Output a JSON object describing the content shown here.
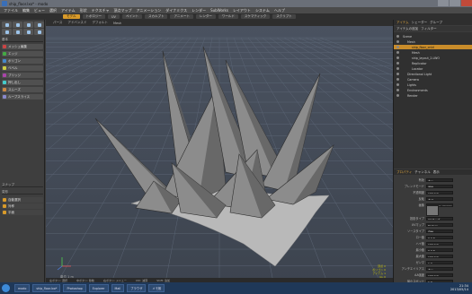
{
  "window": {
    "title": "ship_floor.lxo* - modo"
  },
  "menubar": [
    "ファイル",
    "編集",
    "ビュー",
    "選択",
    "アイテム",
    "形状",
    "テクスチャ",
    "頂点マップ",
    "アニメーション",
    "ダイナミクス",
    "レンダー",
    "SubWorks",
    "レイアウト",
    "システム",
    "ヘルプ"
  ],
  "layout_tabs": [
    {
      "label": "モデル",
      "active": true
    },
    {
      "label": "トポロジー",
      "active": false
    },
    {
      "label": "UV",
      "active": false
    },
    {
      "label": "ペイント",
      "active": false
    },
    {
      "label": "スカルプト",
      "active": false
    },
    {
      "label": "アニメート",
      "active": false
    },
    {
      "label": "レンダー",
      "active": false
    },
    {
      "label": "ワールド",
      "active": false
    },
    {
      "label": "スケマティック",
      "active": false
    },
    {
      "label": "スクリプト",
      "active": false
    }
  ],
  "left_panel": {
    "section1": "基本",
    "buttons": [
      "メッシュ編集",
      "エッジ",
      "ポリゴン",
      "ベベル",
      "ブリッジ",
      "押し出し",
      "スムーズ",
      "ループスライス"
    ],
    "section2": "スナップ",
    "section3": "変形",
    "checks": [
      "自動選択",
      "対称",
      "平面"
    ]
  },
  "viewport": {
    "header": [
      "パース",
      "アドバンスド",
      "デフォルト",
      "Mesh"
    ],
    "footer_left": "単位 1 m",
    "footer_right": [
      "頂点 0",
      "ポリゴン 0",
      "アイテム 1",
      "GL 0"
    ]
  },
  "right_panel": {
    "tabs": [
      {
        "label": "アイテム",
        "on": true
      },
      {
        "label": "シェーダー",
        "on": false
      },
      {
        "label": "グループ",
        "on": false
      }
    ],
    "subtabs": [
      {
        "label": "アイテムの追加",
        "on": false
      },
      {
        "label": "フィルター",
        "on": false
      }
    ],
    "tree": [
      {
        "label": "Scene",
        "indent": 0,
        "sel": false
      },
      {
        "label": "Mesh",
        "indent": 1,
        "sel": false
      },
      {
        "label": "ship_floor_cntrl",
        "indent": 2,
        "sel": true
      },
      {
        "label": "Mesh",
        "indent": 2,
        "sel": false
      },
      {
        "label": "ship_layout_2.LWO",
        "indent": 2,
        "sel": false
      },
      {
        "label": "Replicator",
        "indent": 2,
        "sel": false
      },
      {
        "label": "Locator",
        "indent": 2,
        "sel": false
      },
      {
        "label": "Directional Light",
        "indent": 1,
        "sel": false
      },
      {
        "label": "Camera",
        "indent": 1,
        "sel": false
      },
      {
        "label": "Lights",
        "indent": 1,
        "sel": false
      },
      {
        "label": "Environments",
        "indent": 1,
        "sel": false
      },
      {
        "label": "Render",
        "indent": 1,
        "sel": false
      }
    ],
    "props_tabs": [
      {
        "label": "プロパティ",
        "on": true
      },
      {
        "label": "チャンネル",
        "on": false
      },
      {
        "label": "表示",
        "on": false
      }
    ],
    "props": [
      {
        "label": "有効",
        "value": "オン"
      },
      {
        "label": "ブレンドモード",
        "value": "通常"
      },
      {
        "label": "不透明度",
        "value": "100.0 %"
      },
      {
        "label": "反転",
        "value": "オフ"
      },
      {
        "label": "画像",
        "value": "ship_floor_grunge"
      },
      {
        "label": "投影タイプ",
        "value": "UVマップ"
      },
      {
        "label": "UVマップ",
        "value": "Texture"
      },
      {
        "label": "ソースタイプ",
        "value": "自動"
      },
      {
        "label": "ロー値",
        "value": "0.0 %"
      },
      {
        "label": "ハイ値",
        "value": "100.0 %"
      },
      {
        "label": "最小値",
        "value": "0.0 %"
      },
      {
        "label": "最大値",
        "value": "100.0 %"
      },
      {
        "label": "ガンマ",
        "value": "1.0"
      },
      {
        "label": "アンチエイリアス",
        "value": "オン"
      },
      {
        "label": "AA強度",
        "value": "100.0 %"
      },
      {
        "label": "最小スポット",
        "value": "1.0"
      }
    ]
  },
  "bottom_hint": [
    "左ボタン: 選択",
    "中ボタン: 移動",
    "右ボタン: メニュー",
    "Ctrl: 減算",
    "Shift: 追加"
  ],
  "taskbar": {
    "items": [
      "modo",
      "ship_floor.lxo*",
      "Photoshop",
      "Explorer",
      "Mail",
      "ブラウザ",
      "メモ帳"
    ],
    "time": "21:34",
    "date": "2013/05/14"
  }
}
